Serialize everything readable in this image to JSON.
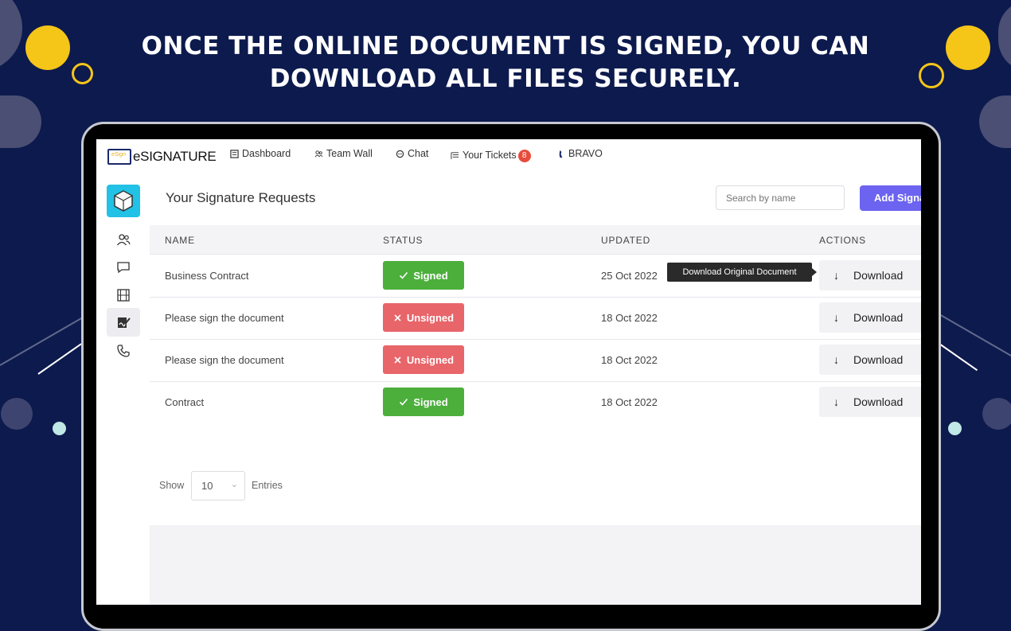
{
  "headline": {
    "line1": "ONCE THE ONLINE DOCUMENT IS SIGNED, YOU CAN",
    "line2": "DOWNLOAD ALL FILES SECURELY."
  },
  "app": {
    "logo_text": "eSIGNATURE",
    "logo_mark": "eSign"
  },
  "nav": {
    "items": [
      {
        "label": "Dashboard",
        "icon": "dashboard-icon"
      },
      {
        "label": "Team Wall",
        "icon": "team-icon"
      },
      {
        "label": "Chat",
        "icon": "chat-icon"
      },
      {
        "label": "Your Tickets",
        "icon": "tickets-icon",
        "badge": "8"
      },
      {
        "label": "BRAVO",
        "icon": "user-icon"
      }
    ]
  },
  "sidebar": {
    "items": [
      "users-icon",
      "chat-bubble-icon",
      "film-icon",
      "signature-icon",
      "phone-icon"
    ],
    "active": "signature-icon"
  },
  "main": {
    "title": "Your Signature Requests",
    "search_placeholder": "Search by name",
    "add_button": "Add Signature"
  },
  "table": {
    "headers": [
      "NAME",
      "STATUS",
      "UPDATED",
      "ACTIONS"
    ],
    "rows": [
      {
        "name": "Business Contract",
        "status": "Signed",
        "status_type": "signed",
        "updated": "25 Oct 2022",
        "action": "Download"
      },
      {
        "name": "Please sign the document",
        "status": "Unsigned",
        "status_type": "unsigned",
        "updated": "18 Oct 2022",
        "action": "Download"
      },
      {
        "name": "Please sign the document",
        "status": "Unsigned",
        "status_type": "unsigned",
        "updated": "18 Oct 2022",
        "action": "Download"
      },
      {
        "name": "Contract",
        "status": "Signed",
        "status_type": "signed",
        "updated": "18 Oct 2022",
        "action": "Download"
      }
    ],
    "tooltip": "Download Original Document"
  },
  "pagination": {
    "show_label": "Show",
    "entries_value": "10",
    "entries_label": "Entries"
  },
  "colors": {
    "background": "#0d1a4d",
    "accent": "#6c63f0",
    "signed": "#4caf3c",
    "unsigned": "#e8656a",
    "decor_yellow": "#f5c518",
    "sidebar_logo": "#22c1e6"
  }
}
